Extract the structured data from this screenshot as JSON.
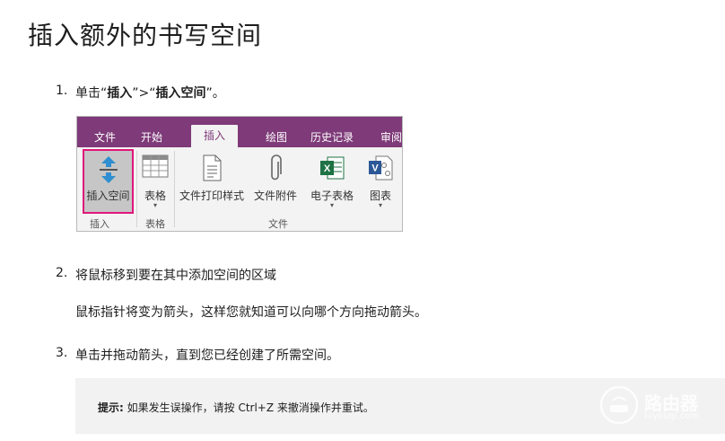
{
  "title": "插入额外的书写空间",
  "steps": [
    {
      "num": "1.",
      "prefix": "单击“",
      "bold1": "插入",
      "mid": "”>“",
      "bold2": "插入空间",
      "suffix": "”。"
    },
    {
      "num": "2.",
      "text": "将鼠标移到要在其中添加空间的区域"
    },
    {
      "num": "3.",
      "text": "单击并拖动箭头，直到您已经创建了所需空间。"
    }
  ],
  "step2_note": "鼠标指针将变为箭头，这样您就知道可以向哪个方向拖动箭头。",
  "ribbon": {
    "tabs": [
      "文件",
      "开始",
      "插入",
      "绘图",
      "历史记录",
      "审阅"
    ],
    "active_tab": "插入",
    "tools": [
      {
        "label": "插入空间",
        "icon": "insert-space-icon",
        "selected": true
      },
      {
        "label": "表格",
        "icon": "table-icon",
        "caret": "▾"
      },
      {
        "label": "文件打印样式",
        "icon": "file-printout-icon"
      },
      {
        "label": "文件附件",
        "icon": "paperclip-icon"
      },
      {
        "label": "电子表格",
        "icon": "excel-icon",
        "caret": "▾"
      },
      {
        "label": "图表",
        "icon": "visio-icon",
        "caret": "▾"
      }
    ],
    "groups": [
      "插入",
      "表格",
      "文件"
    ],
    "colors": {
      "tabbar": "#7e3a79",
      "highlight": "#e0177a",
      "excel": "#1f7244",
      "visio": "#2b5797"
    }
  },
  "tip": {
    "label": "提示:",
    "text": "如果发生误操作，请按 Ctrl+Z 来撤消操作并重试。"
  },
  "watermark": {
    "text": "路由器",
    "sub": "luyouqi.com"
  }
}
